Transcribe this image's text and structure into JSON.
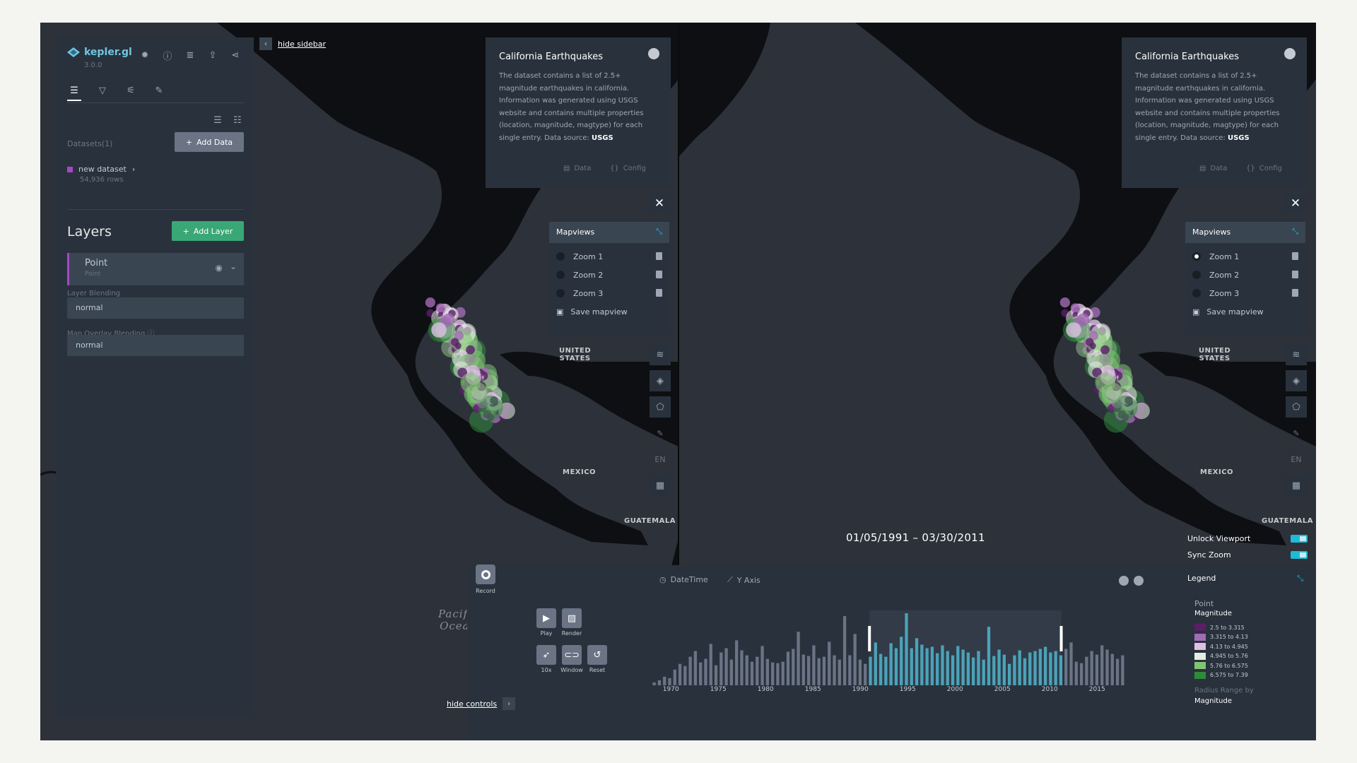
{
  "app": {
    "name": "kepler.gl",
    "version": "3.0.0"
  },
  "sidebar": {
    "tabs": [
      "layers",
      "filters",
      "interactions",
      "base-map"
    ],
    "datasets_label": "Datasets(1)",
    "add_data": "Add Data",
    "dataset": {
      "name": "new dataset",
      "rows": "54,936 rows",
      "color": "#a646c6"
    },
    "layers_title": "Layers",
    "add_layer": "Add Layer",
    "layer": {
      "name": "Point",
      "type": "Point"
    },
    "layer_blending_label": "Layer Blending",
    "layer_blending_value": "normal",
    "overlay_blending_label": "Map Overlay Blending",
    "overlay_blending_value": "normal",
    "hide_sidebar": "hide sidebar"
  },
  "info_panel": {
    "title": "California Earthquakes",
    "desc_a": "The dataset contains a list of 2.5+ magnitude earthquakes in california. Information was generated using USGS website and contains multiple properties (location, magnitude, magtype) for each single entry. Data source: ",
    "desc_link": "USGS",
    "data_btn": "Data",
    "config_btn": "Config"
  },
  "mapviews": {
    "title": "Mapviews",
    "items": [
      "Zoom 1",
      "Zoom 2",
      "Zoom 3"
    ],
    "save": "Save mapview",
    "left_selected": null,
    "right_selected": "Zoom 1"
  },
  "map_labels": {
    "us": "UNITED\nSTATES",
    "mexico": "MEXICO",
    "guatemala": "GUATEMALA",
    "ocean": "Pacific\nOcean",
    "lang": "EN"
  },
  "timeline": {
    "range": "01/05/1991  –  03/30/2011",
    "record": "Record",
    "play": "Play",
    "render": "Render",
    "speed": "10x",
    "window": "Window",
    "reset": "Reset",
    "x_axis_label": "DateTime",
    "y_axis_label": "Y Axis",
    "hide_controls": "hide controls",
    "ticks": [
      "1970",
      "1975",
      "1980",
      "1985",
      "1990",
      "1995",
      "2000",
      "2005",
      "2010",
      "2015"
    ]
  },
  "map_controls": {
    "unlock_viewport": "Unlock Viewport",
    "sync_zoom": "Sync Zoom",
    "legend_title": "Legend"
  },
  "legend": {
    "layer": "Point",
    "field": "Magnitude",
    "items": [
      {
        "label": "2.5 to 3.315",
        "color": "#5a1e69"
      },
      {
        "label": "3.315 to 4.13",
        "color": "#a26bb4"
      },
      {
        "label": "4.13 to 4.945",
        "color": "#dcc1e2"
      },
      {
        "label": "4.945 to 5.76",
        "color": "#e6ece2"
      },
      {
        "label": "5.76 to 6.575",
        "color": "#7fc472"
      },
      {
        "label": "6.575 to 7.39",
        "color": "#2f8a3c"
      }
    ],
    "radius_label": "Radius Range by",
    "radius_field": "Magnitude"
  },
  "chart_data": {
    "type": "bar",
    "x_range": [
      1968,
      2018
    ],
    "selected_range": [
      1991.0,
      2011.25
    ],
    "values": [
      4,
      7,
      12,
      10,
      22,
      30,
      27,
      40,
      48,
      32,
      37,
      58,
      28,
      46,
      52,
      36,
      63,
      49,
      42,
      33,
      40,
      55,
      37,
      32,
      31,
      33,
      47,
      51,
      75,
      43,
      41,
      56,
      38,
      40,
      61,
      42,
      36,
      97,
      42,
      72,
      36,
      30,
      40,
      60,
      44,
      40,
      59,
      52,
      68,
      101,
      52,
      66,
      57,
      52,
      54,
      45,
      56,
      48,
      42,
      55,
      50,
      46,
      39,
      48,
      36,
      82,
      41,
      50,
      43,
      30,
      42,
      49,
      38,
      46,
      48,
      51,
      54,
      46,
      48,
      42,
      51,
      60,
      33,
      31,
      40,
      48,
      43,
      56,
      50,
      44,
      37,
      42
    ]
  }
}
